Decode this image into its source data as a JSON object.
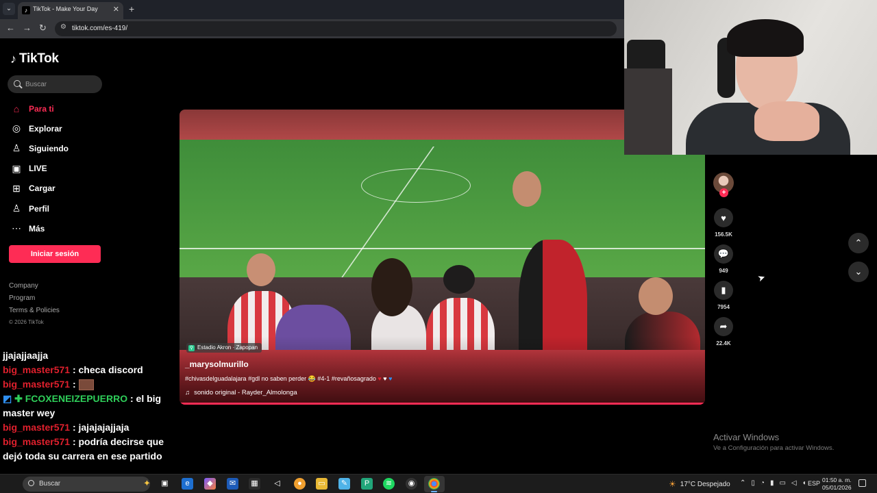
{
  "browser": {
    "tab_title": "TikTok - Make Your Day",
    "url": "tiktok.com/es-419/"
  },
  "sidebar": {
    "logo": "TikTok",
    "search_placeholder": "Buscar",
    "items": [
      {
        "label": "Para ti",
        "icon": "home-icon"
      },
      {
        "label": "Explorar",
        "icon": "compass-icon"
      },
      {
        "label": "Siguiendo",
        "icon": "following-icon"
      },
      {
        "label": "LIVE",
        "icon": "live-icon"
      },
      {
        "label": "Cargar",
        "icon": "upload-icon"
      },
      {
        "label": "Perfil",
        "icon": "profile-icon"
      },
      {
        "label": "Más",
        "icon": "more-icon"
      }
    ],
    "login_label": "Iniciar sesión",
    "footer": [
      "Company",
      "Program",
      "Terms & Policies"
    ],
    "copyright": "© 2026 TikTok",
    "accent_color": "#fe2c55"
  },
  "chat": [
    {
      "user": "",
      "message": "jjajajjaajja"
    },
    {
      "user": "big_master571",
      "message": ": checa discord"
    },
    {
      "user": "big_master571",
      "message": ": "
    },
    {
      "user": "FCOXENEIZEPUERRO",
      "message": ": el big master wey"
    },
    {
      "user": "big_master571",
      "message": ": jajajajajjaja"
    },
    {
      "user": "big_master571",
      "message": ": podría decirse que dejó toda su carrera en ese partido"
    }
  ],
  "video": {
    "location": "Estadio Akron · Zapopan",
    "author": "_marysolmurillo",
    "caption": "#chivasdelguadalajara #gdl no saben perder 😂 #4-1 #revañosagrado",
    "sound": "sonido original - Rayder_Almolonga"
  },
  "actions": {
    "likes": "156.5K",
    "comments": "949",
    "saves": "7954",
    "shares": "22.4K"
  },
  "windows_watermark": {
    "title": "Activar Windows",
    "subtitle": "Ve a Configuración para activar Windows."
  },
  "taskbar": {
    "search_label": "Buscar",
    "weather": "17°C  Despejado",
    "language": "ESP",
    "time": "01:50 a. m.",
    "date": "05/01/2026"
  }
}
